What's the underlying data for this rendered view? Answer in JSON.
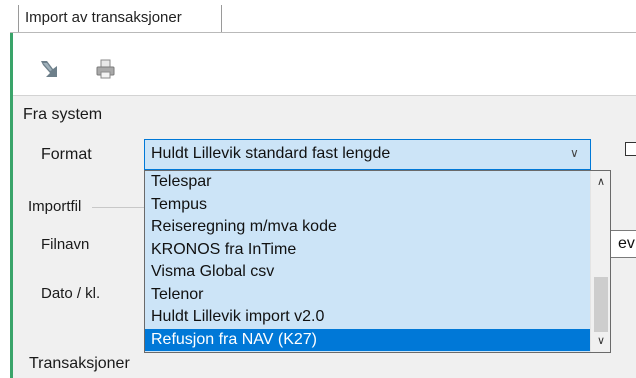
{
  "tab": {
    "label": "Import av transaksjoner"
  },
  "toolbar": {
    "import_icon": "import-arrow-icon",
    "print_icon": "printer-icon"
  },
  "sections": {
    "fra_system": "Fra system",
    "importfil": "Importfil",
    "transaksjoner": "Transaksjoner"
  },
  "fields": {
    "format_label": "Format",
    "format_value": "Huldt Lillevik standard fast lengde",
    "filnavn_label": "Filnavn",
    "filnavn_value_partial": "ev",
    "dato_label": "Dato / kl."
  },
  "dropdown": {
    "options": [
      "Telespar",
      "Tempus",
      "Reiseregning m/mva kode",
      "KRONOS fra InTime",
      "Visma Global csv",
      "Telenor",
      "Huldt Lillevik import v2.0",
      "Refusjon fra NAV (K27)"
    ],
    "selected": "Refusjon fra NAV (K27)"
  },
  "colors": {
    "accent": "#0078d7",
    "list_bg": "#cce4f7",
    "panel_bg": "#f0f0f0",
    "left_bar": "#3aa46a"
  }
}
